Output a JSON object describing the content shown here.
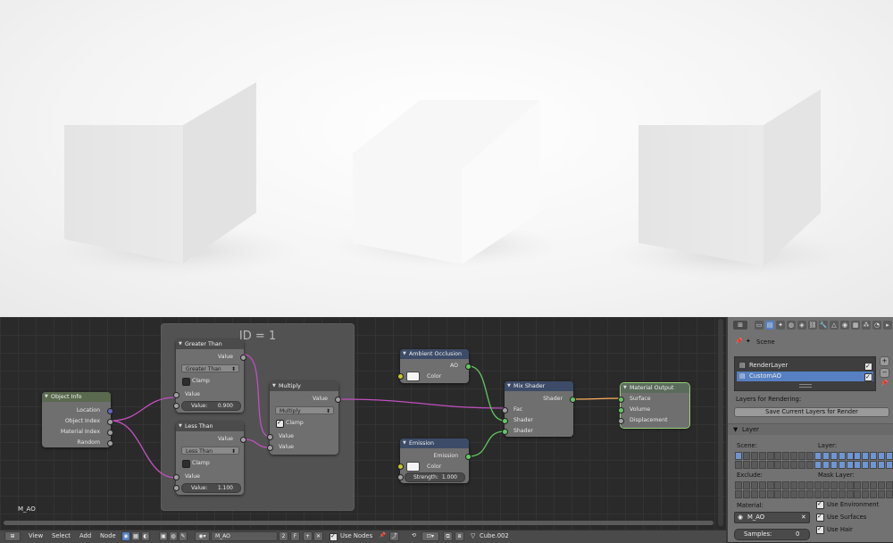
{
  "render": {
    "note": ""
  },
  "frame": {
    "label": "ID = 1"
  },
  "nodes": {
    "object_info": {
      "title": "Object Info",
      "outputs": [
        "Location",
        "Object Index",
        "Material Index",
        "Random"
      ]
    },
    "greater_than": {
      "title": "Greater Than",
      "out": "Value",
      "op": "Greater Than",
      "clamp": "Clamp",
      "in": "Value",
      "field_label": "Value:",
      "field_value": "0.900"
    },
    "less_than": {
      "title": "Less Than",
      "out": "Value",
      "op": "Less Than",
      "clamp": "Clamp",
      "in": "Value",
      "field_label": "Value:",
      "field_value": "1.100"
    },
    "multiply": {
      "title": "Multiply",
      "out": "Value",
      "op": "Multiply",
      "clamp": "Clamp",
      "in1": "Value",
      "in2": "Value"
    },
    "ambient_occlusion": {
      "title": "Ambient Occlusion",
      "out": "AO",
      "color": "Color"
    },
    "emission": {
      "title": "Emission",
      "out": "Emission",
      "color": "Color",
      "strength_label": "Strength:",
      "strength_value": "1.000"
    },
    "mix_shader": {
      "title": "Mix Shader",
      "out": "Shader",
      "fac": "Fac",
      "s1": "Shader",
      "s2": "Shader"
    },
    "material_output": {
      "title": "Material Output",
      "surface": "Surface",
      "volume": "Volume",
      "displacement": "Displacement"
    }
  },
  "editor": {
    "material_label": "M_AO"
  },
  "header": {
    "menus": [
      "View",
      "Select",
      "Add",
      "Node"
    ],
    "material": "M_AO",
    "users": "2",
    "fake": "F",
    "use_nodes": "Use Nodes",
    "object": "Cube.002"
  },
  "props": {
    "scene": "Scene",
    "render_layers": [
      "RenderLayer",
      "CustomAO"
    ],
    "layers_for_rendering": "Layers for Rendering:",
    "save_layers": "Save Current Layers for Render",
    "layer_section": "Layer",
    "scene_label": "Scene:",
    "layer_label": "Layer:",
    "exclude_label": "Exclude:",
    "mask_layer_label": "Mask Layer:",
    "material_label": "Material:",
    "material_value": "M_AO",
    "use_environment": "Use Environment",
    "use_surfaces": "Use Surfaces",
    "use_hair": "Use Hair",
    "samples_label": "Samples:",
    "samples_value": "0"
  },
  "colors": {
    "wire": "#c050c0",
    "selected_list": "#5680c2",
    "node_green": "#63c763",
    "node_yellow": "#c7c729"
  }
}
